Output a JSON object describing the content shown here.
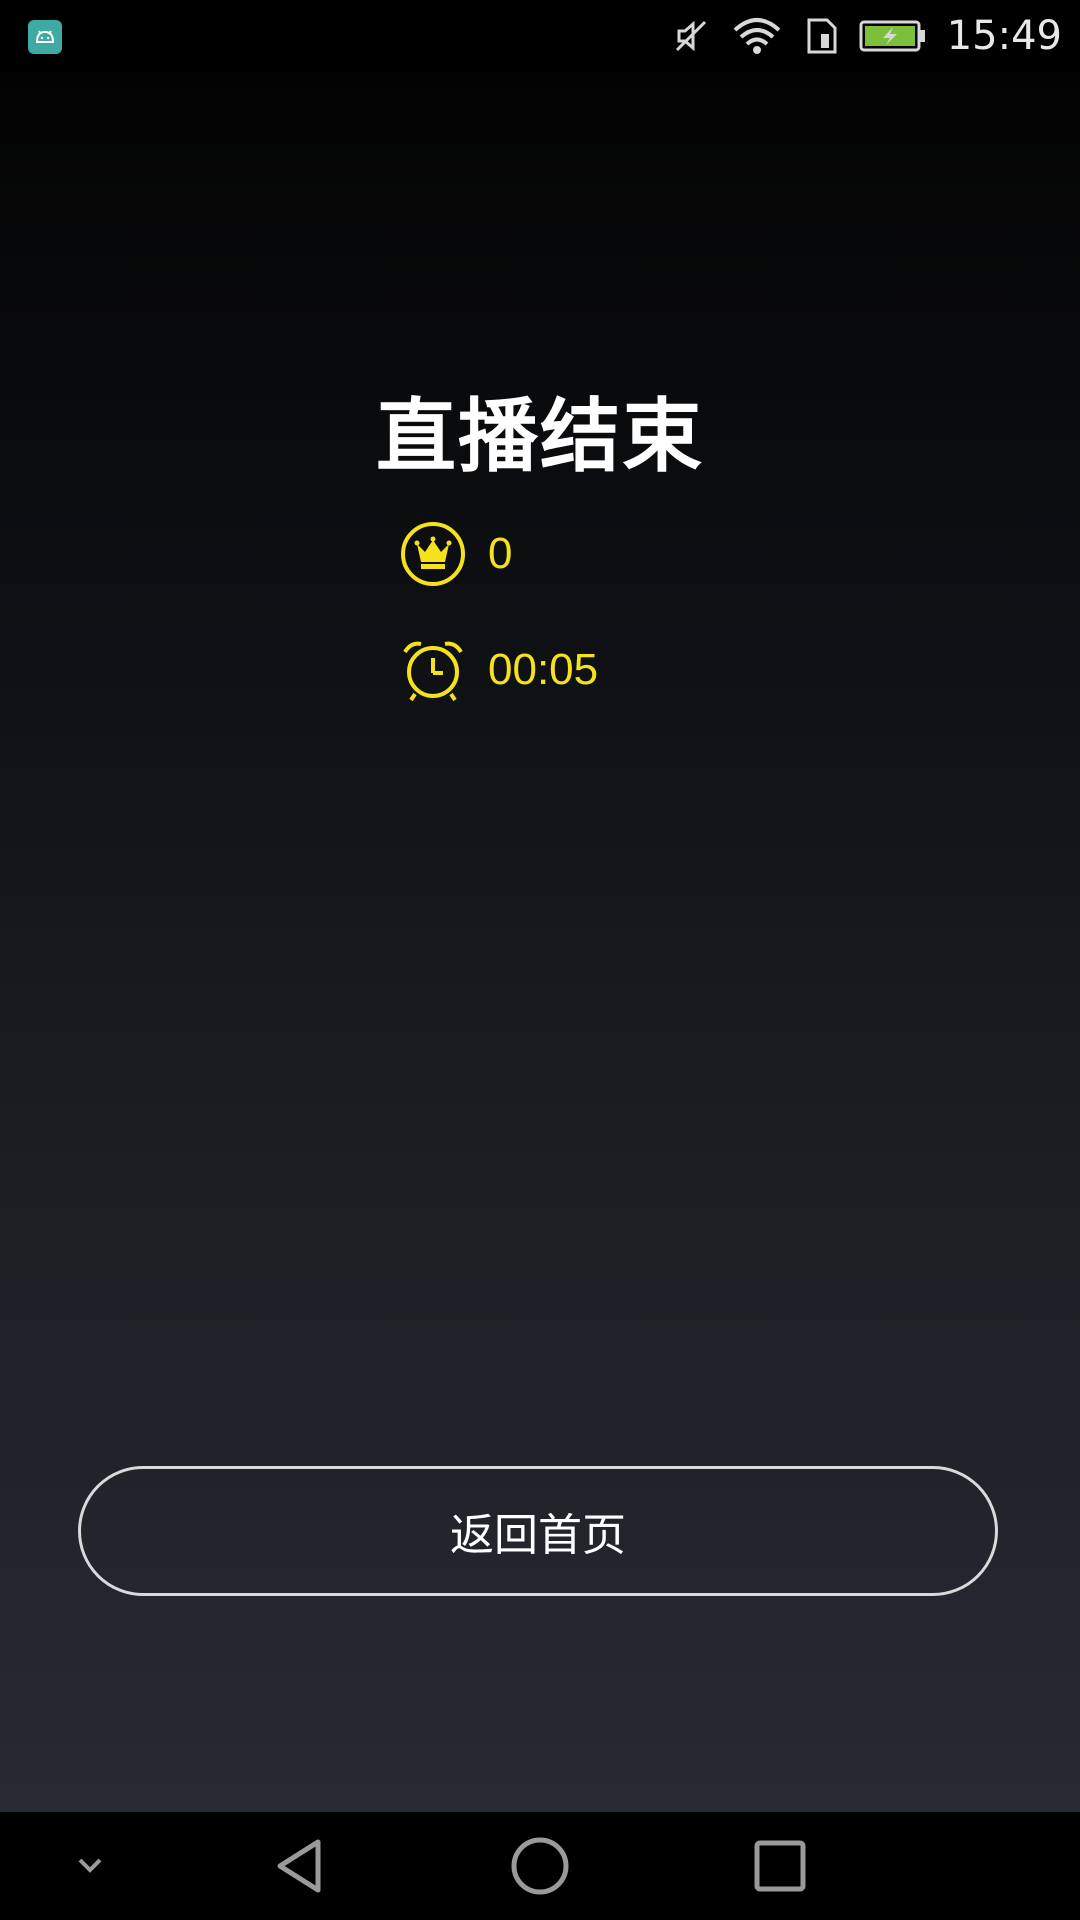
{
  "status_bar": {
    "time": "15:49",
    "icons": [
      "android-app-icon",
      "mute-icon",
      "wifi-icon",
      "sim-icon",
      "battery-charging-icon"
    ]
  },
  "main": {
    "title": "直播结束",
    "stats": [
      {
        "icon": "crown-icon",
        "value": "0"
      },
      {
        "icon": "alarm-clock-icon",
        "value": "00:05"
      }
    ],
    "home_button_label": "返回首页"
  },
  "nav_bar": {
    "buttons": [
      "collapse-chevron-icon",
      "back-icon",
      "home-icon",
      "recents-icon"
    ]
  },
  "colors": {
    "accent_yellow": "#f6e11d",
    "text_white": "#ffffff",
    "button_border": "#d9d9d9",
    "app_icon_teal": "#3fa9a4"
  }
}
